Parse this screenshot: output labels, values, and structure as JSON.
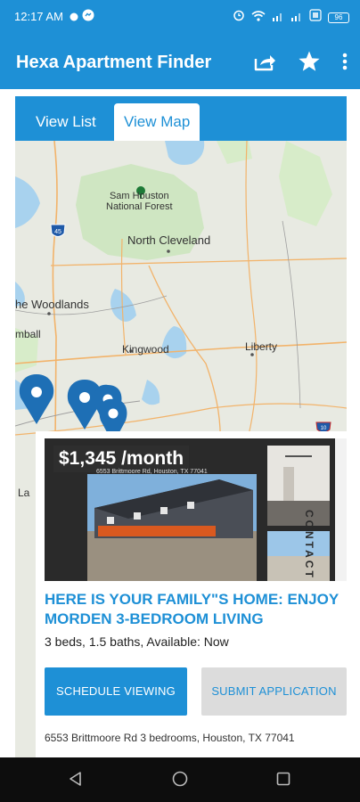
{
  "status_bar": {
    "time": "12:17 AM",
    "battery": "96",
    "icons": [
      "whatsapp-icon",
      "messenger-icon",
      "alarm-icon",
      "wifi-icon",
      "signal-icon",
      "signal-icon",
      "volte-icon"
    ]
  },
  "app_bar": {
    "title": "Hexa Apartment Finder",
    "actions": [
      "share-icon",
      "star-icon",
      "more-vert-icon"
    ]
  },
  "tabs": [
    {
      "label": "View List",
      "selected": false
    },
    {
      "label": "View Map",
      "selected": true
    }
  ],
  "map": {
    "labels": {
      "forest": "Sam Houston\nNational Forest",
      "north_cleveland": "North Cleveland",
      "woodlands": "he Woodlands",
      "kingwood": "Kingwood",
      "liberty": "Liberty",
      "tomball": "mball",
      "la": "La"
    },
    "highway_shields": [
      "45",
      "10"
    ]
  },
  "listing": {
    "price": "$1,345 /month",
    "photo_caption": "6553 Brittmoore Rd, Houston, TX 77041",
    "watermark": "CONTACT NOW",
    "title": "HERE IS YOUR FAMILY\"S HOME: ENJOY MORDEN 3-BEDROOM LIVING",
    "details": "3 beds, 1.5 baths, Available: Now",
    "schedule_label": "SCHEDULE VIEWING",
    "apply_label": "SUBMIT APPLICATION",
    "address": "6553 Brittmoore Rd 3 bedrooms, Houston, TX 77041"
  },
  "colors": {
    "primary": "#1e90d6",
    "map_bg": "#e8eae2",
    "forest": "#cfe6c2",
    "water": "#a8d2ee",
    "nav_bar": "#0d0d0d"
  }
}
